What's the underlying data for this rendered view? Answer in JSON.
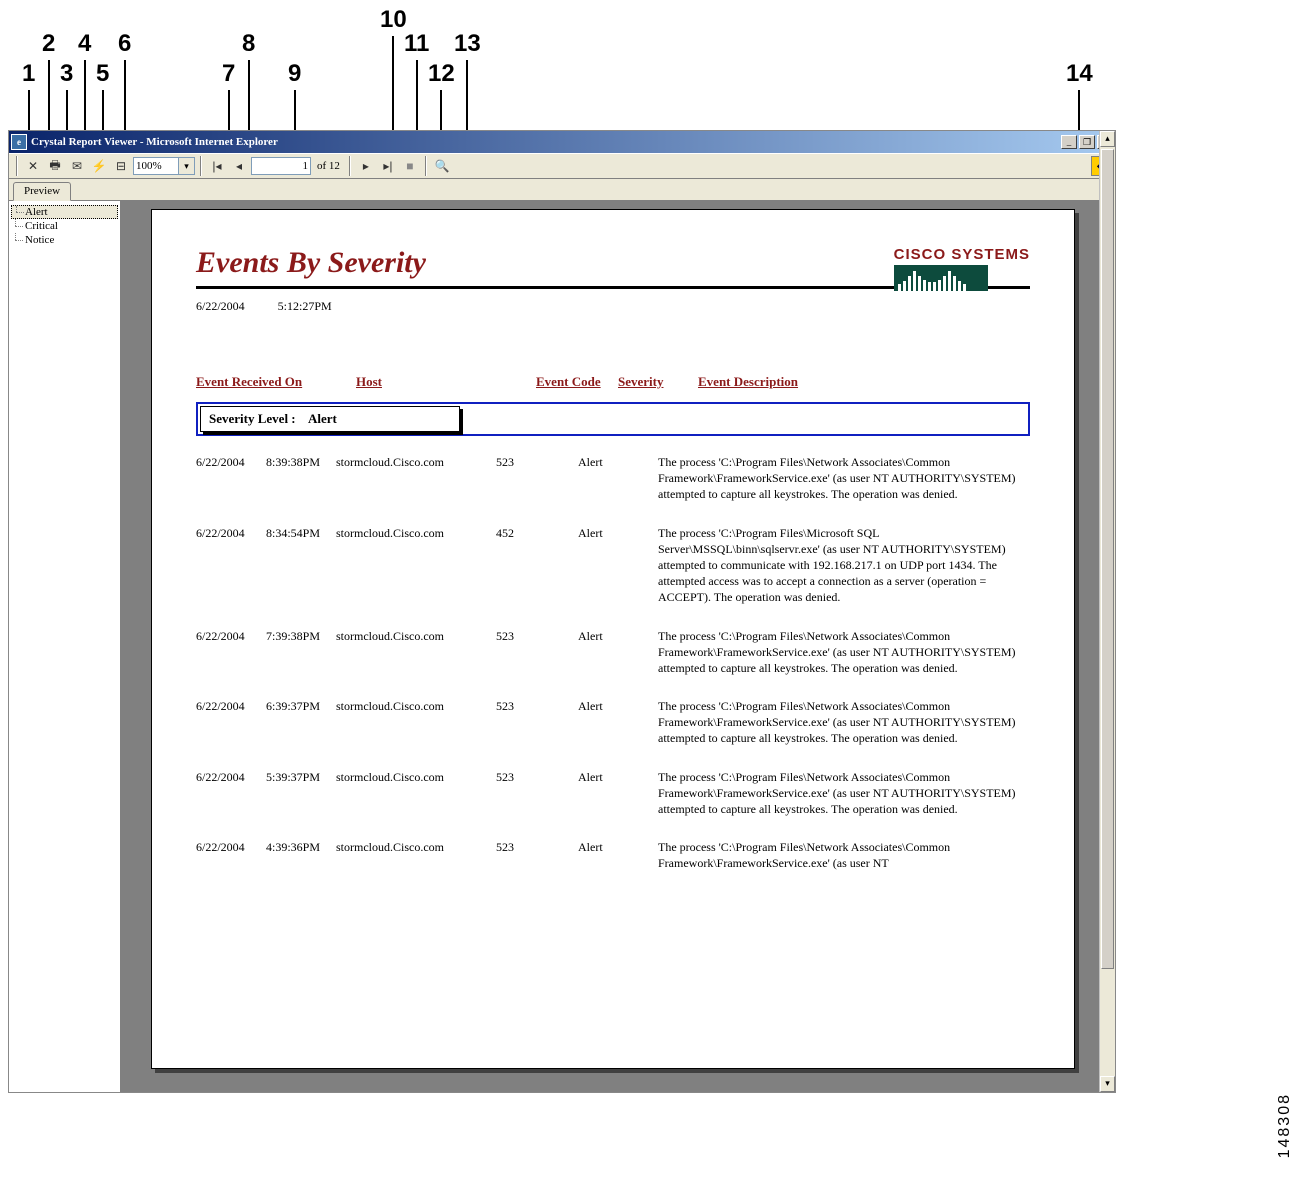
{
  "annotations": {
    "callouts": [
      "1",
      "2",
      "3",
      "4",
      "5",
      "6",
      "7",
      "8",
      "9",
      "10",
      "11",
      "12",
      "13",
      "14"
    ],
    "figure_number": "148308"
  },
  "window": {
    "title": "Crystal Report Viewer - Microsoft Internet Explorer",
    "min_label": "_",
    "max_label": "❐",
    "close_label": "✕"
  },
  "toolbar": {
    "close_tip": "✕",
    "print_tip": "🖨",
    "export_tip": "✉",
    "refresh_tip": "⚡",
    "toggle_tree_tip": "├",
    "zoom_value": "100%",
    "first_tip": "|◄",
    "prev_tip": "◄",
    "page_value": "1",
    "of_label": "of",
    "total_pages": "12",
    "next_tip": "►",
    "last_tip": "►|",
    "stop_tip": "■",
    "find_tip": "🔍",
    "crystal_logo": "卐"
  },
  "tabs": {
    "preview": "Preview"
  },
  "tree": {
    "items": [
      "Alert",
      "Critical",
      "Notice"
    ],
    "selected_index": 0
  },
  "report": {
    "title": "Events By Severity",
    "date": "6/22/2004",
    "time": "5:12:27PM",
    "brand": "CISCO SYSTEMS",
    "columns": {
      "received": "Event Received On",
      "host": "Host",
      "code": "Event Code",
      "severity": "Severity",
      "description": "Event Description"
    },
    "group_label": "Severity Level :",
    "group_value": "Alert",
    "events": [
      {
        "date": "6/22/2004",
        "time": "8:39:38PM",
        "host": "stormcloud.Cisco.com",
        "code": "523",
        "severity": "Alert",
        "desc": "The process 'C:\\Program Files\\Network Associates\\Common Framework\\FrameworkService.exe' (as user NT AUTHORITY\\SYSTEM) attempted to capture all keystrokes. The operation was denied."
      },
      {
        "date": "6/22/2004",
        "time": "8:34:54PM",
        "host": "stormcloud.Cisco.com",
        "code": "452",
        "severity": "Alert",
        "desc": "The process 'C:\\Program Files\\Microsoft SQL Server\\MSSQL\\binn\\sqlservr.exe' (as user NT AUTHORITY\\SYSTEM) attempted to communicate with 192.168.217.1 on UDP port 1434. The attempted access was to accept a connection as a server (operation = ACCEPT). The operation was denied."
      },
      {
        "date": "6/22/2004",
        "time": "7:39:38PM",
        "host": "stormcloud.Cisco.com",
        "code": "523",
        "severity": "Alert",
        "desc": "The process 'C:\\Program Files\\Network Associates\\Common Framework\\FrameworkService.exe' (as user NT AUTHORITY\\SYSTEM) attempted to capture all keystrokes. The operation was denied."
      },
      {
        "date": "6/22/2004",
        "time": "6:39:37PM",
        "host": "stormcloud.Cisco.com",
        "code": "523",
        "severity": "Alert",
        "desc": "The process 'C:\\Program Files\\Network Associates\\Common Framework\\FrameworkService.exe' (as user NT AUTHORITY\\SYSTEM) attempted to capture all keystrokes. The operation was denied."
      },
      {
        "date": "6/22/2004",
        "time": "5:39:37PM",
        "host": "stormcloud.Cisco.com",
        "code": "523",
        "severity": "Alert",
        "desc": "The process 'C:\\Program Files\\Network Associates\\Common Framework\\FrameworkService.exe' (as user NT AUTHORITY\\SYSTEM) attempted to capture all keystrokes. The operation was denied."
      },
      {
        "date": "6/22/2004",
        "time": "4:39:36PM",
        "host": "stormcloud.Cisco.com",
        "code": "523",
        "severity": "Alert",
        "desc": "The process 'C:\\Program Files\\Network Associates\\Common Framework\\FrameworkService.exe' (as user NT"
      }
    ]
  }
}
